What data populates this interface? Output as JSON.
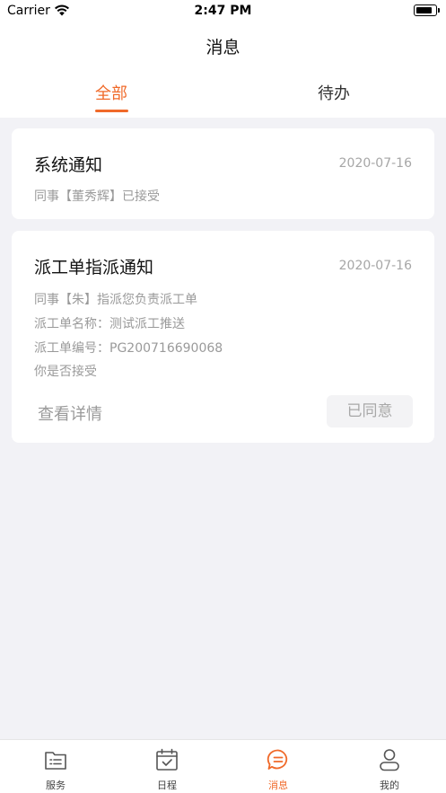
{
  "status_bar": {
    "carrier": "Carrier",
    "time": "2:47 PM",
    "battery_level": 0.85
  },
  "nav": {
    "title": "消息"
  },
  "tabs": [
    {
      "label": "全部",
      "active": true
    },
    {
      "label": "待办",
      "active": false
    }
  ],
  "messages": [
    {
      "title": "系统通知",
      "date": "2020-07-16",
      "lines": [
        "同事【董秀辉】已接受"
      ]
    },
    {
      "title": "派工单指派通知",
      "date": "2020-07-16",
      "lines": [
        "同事【朱】指派您负责派工单",
        "派工单名称：测试派工推送",
        "派工单编号：PG200716690068",
        "你是否接受"
      ],
      "detail_label": "查看详情",
      "status_button": "已同意"
    }
  ],
  "tab_bar": [
    {
      "label": "服务",
      "icon": "service-icon",
      "active": false
    },
    {
      "label": "日程",
      "icon": "calendar-check-icon",
      "active": false
    },
    {
      "label": "消息",
      "icon": "message-bubble-icon",
      "active": true
    },
    {
      "label": "我的",
      "icon": "profile-icon",
      "active": false
    }
  ],
  "colors": {
    "accent": "#f06a2a",
    "background": "#f2f2f6",
    "muted_text": "#9a9a9a"
  }
}
